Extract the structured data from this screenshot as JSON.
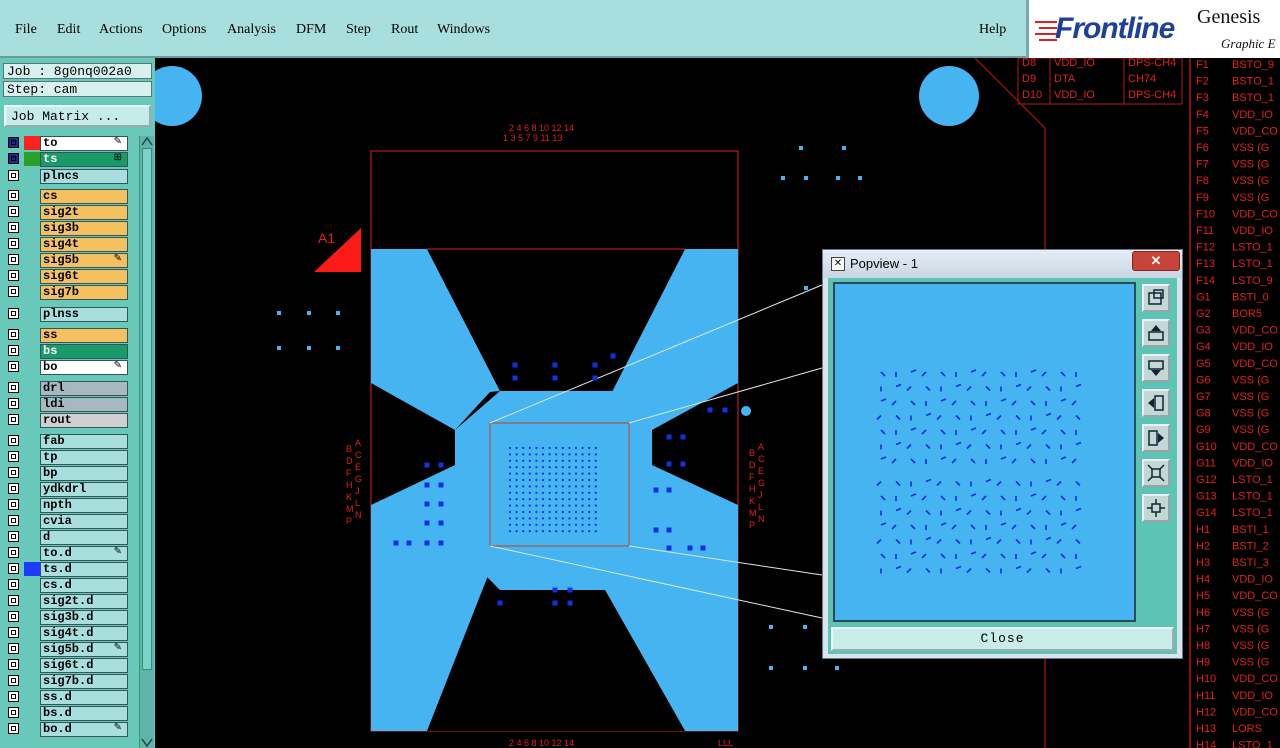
{
  "menubar": {
    "items": [
      "File",
      "Edit",
      "Actions",
      "Options",
      "Analysis",
      "DFM",
      "Step",
      "Rout",
      "Windows"
    ],
    "help": "Help"
  },
  "logo": {
    "brand_a": "Front",
    "brand_b": "line",
    "genesis": "Genesis",
    "subtitle": "Graphic E"
  },
  "job": {
    "job_line": "Job : 8g0nq002a0",
    "step_line": "Step: cam",
    "matrix_button": "Job Matrix ..."
  },
  "layers": [
    {
      "name": "to",
      "color": "#ffffff",
      "swatch": "#ff2020",
      "active": true,
      "flag": "pen"
    },
    {
      "name": "ts",
      "color": "#1a9a6a",
      "swatch": "#2aa02a",
      "active": true,
      "flag": "grid"
    },
    {
      "name": "plncs",
      "color": "#a8dede",
      "swatch": ""
    },
    {
      "name": "cs",
      "color": "#f5c060",
      "swatch": ""
    },
    {
      "name": "sig2t",
      "color": "#f5c060",
      "swatch": ""
    },
    {
      "name": "sig3b",
      "color": "#f5c060",
      "swatch": ""
    },
    {
      "name": "sig4t",
      "color": "#f5c060",
      "swatch": ""
    },
    {
      "name": "sig5b",
      "color": "#f5c060",
      "swatch": "",
      "flag": "pen"
    },
    {
      "name": "sig6t",
      "color": "#f5c060",
      "swatch": ""
    },
    {
      "name": "sig7b",
      "color": "#f5c060",
      "swatch": ""
    },
    {
      "name": "plnss",
      "color": "#a8dede",
      "swatch": ""
    },
    {
      "name": "ss",
      "color": "#f5c060",
      "swatch": ""
    },
    {
      "name": "bs",
      "color": "#1a9a6a",
      "swatch": ""
    },
    {
      "name": "bo",
      "color": "#ffffff",
      "swatch": "",
      "flag": "pen"
    },
    {
      "name": "drl",
      "color": "#a8b8c0",
      "swatch": ""
    },
    {
      "name": "ldi",
      "color": "#a8b8c0",
      "swatch": ""
    },
    {
      "name": "rout",
      "color": "#d0d0d0",
      "swatch": ""
    },
    {
      "name": "fab",
      "color": "#a8dede",
      "swatch": ""
    },
    {
      "name": "tp",
      "color": "#a8dede",
      "swatch": ""
    },
    {
      "name": "bp",
      "color": "#a8dede",
      "swatch": ""
    },
    {
      "name": "ydkdrl",
      "color": "#a8dede",
      "swatch": ""
    },
    {
      "name": "npth",
      "color": "#a8dede",
      "swatch": ""
    },
    {
      "name": "cvia",
      "color": "#a8dede",
      "swatch": ""
    },
    {
      "name": "d",
      "color": "#a8dede",
      "swatch": ""
    },
    {
      "name": "to.d",
      "color": "#a8dede",
      "swatch": "",
      "flag": "pen"
    },
    {
      "name": "ts.d",
      "color": "#a8dede",
      "swatch": "#1e3cff"
    },
    {
      "name": "cs.d",
      "color": "#a8dede",
      "swatch": ""
    },
    {
      "name": "sig2t.d",
      "color": "#a8dede",
      "swatch": ""
    },
    {
      "name": "sig3b.d",
      "color": "#a8dede",
      "swatch": ""
    },
    {
      "name": "sig4t.d",
      "color": "#a8dede",
      "swatch": ""
    },
    {
      "name": "sig5b.d",
      "color": "#a8dede",
      "swatch": "",
      "flag": "pen"
    },
    {
      "name": "sig6t.d",
      "color": "#a8dede",
      "swatch": ""
    },
    {
      "name": "sig7b.d",
      "color": "#a8dede",
      "swatch": ""
    },
    {
      "name": "ss.d",
      "color": "#a8dede",
      "swatch": ""
    },
    {
      "name": "bs.d",
      "color": "#a8dede",
      "swatch": ""
    },
    {
      "name": "bo.d",
      "color": "#a8dede",
      "swatch": "",
      "flag": "pen"
    }
  ],
  "canvas": {
    "label_a1": "A1",
    "col_nums_top": "2 4 6 8 10 12 14",
    "col_nums_bottom": "1 3 5 7 9 11 13",
    "row_letters_left": "A C E G J L N",
    "row_letters_right": "B D F H K M P",
    "bottom_nums": "2 4 6 8 10 12 14"
  },
  "pin_table_top": [
    [
      "D8",
      "VDD_IO",
      "DPS-CH4"
    ],
    [
      "D9",
      "DTA",
      "CH74"
    ],
    [
      "D10",
      "VDD_IO",
      "DPS-CH4"
    ]
  ],
  "pin_list": [
    [
      "F1",
      "BSTO_9"
    ],
    [
      "F2",
      "BSTO_1"
    ],
    [
      "F3",
      "BSTO_1"
    ],
    [
      "F4",
      "VDD_IO"
    ],
    [
      "F5",
      "VDD_CO"
    ],
    [
      "F6",
      "VSS (G"
    ],
    [
      "F7",
      "VSS (G"
    ],
    [
      "F8",
      "VSS (G"
    ],
    [
      "F9",
      "VSS (G"
    ],
    [
      "F10",
      "VDD_CO"
    ],
    [
      "F11",
      "VDD_IO"
    ],
    [
      "F12",
      "LSTO_1"
    ],
    [
      "F13",
      "LSTO_1"
    ],
    [
      "F14",
      "LSTO_9"
    ],
    [
      "G1",
      "BSTI_0"
    ],
    [
      "G2",
      "BOR5"
    ],
    [
      "G3",
      "VDD_CO"
    ],
    [
      "G4",
      "VDD_IO"
    ],
    [
      "G5",
      "VDD_CO"
    ],
    [
      "G6",
      "VSS (G"
    ],
    [
      "G7",
      "VSS (G"
    ],
    [
      "G8",
      "VSS (G"
    ],
    [
      "G9",
      "VSS (G"
    ],
    [
      "G10",
      "VDD_CO"
    ],
    [
      "G11",
      "VDD_IO"
    ],
    [
      "G12",
      "LSTO_1"
    ],
    [
      "G13",
      "LSTO_1"
    ],
    [
      "G14",
      "LSTO_1"
    ],
    [
      "H1",
      "BSTI_1"
    ],
    [
      "H2",
      "BSTI_2"
    ],
    [
      "H3",
      "BSTI_3"
    ],
    [
      "H4",
      "VDD_IO"
    ],
    [
      "H5",
      "VDD_CO"
    ],
    [
      "H6",
      "VSS (G"
    ],
    [
      "H7",
      "VSS (G"
    ],
    [
      "H8",
      "VSS (G"
    ],
    [
      "H9",
      "VSS (G"
    ],
    [
      "H10",
      "VDD_CO"
    ],
    [
      "H11",
      "VDD_IO"
    ],
    [
      "H12",
      "VDD_CO"
    ],
    [
      "H13",
      "LORS"
    ],
    [
      "H14",
      "LSTO_1"
    ]
  ],
  "popview": {
    "title": "Popview - 1",
    "close_label": "Close",
    "close_x": "✕"
  },
  "colors": {
    "board": "#45b4f0",
    "outline": "#e02020",
    "via": "#1530e0",
    "panel": "#68c8ba"
  }
}
